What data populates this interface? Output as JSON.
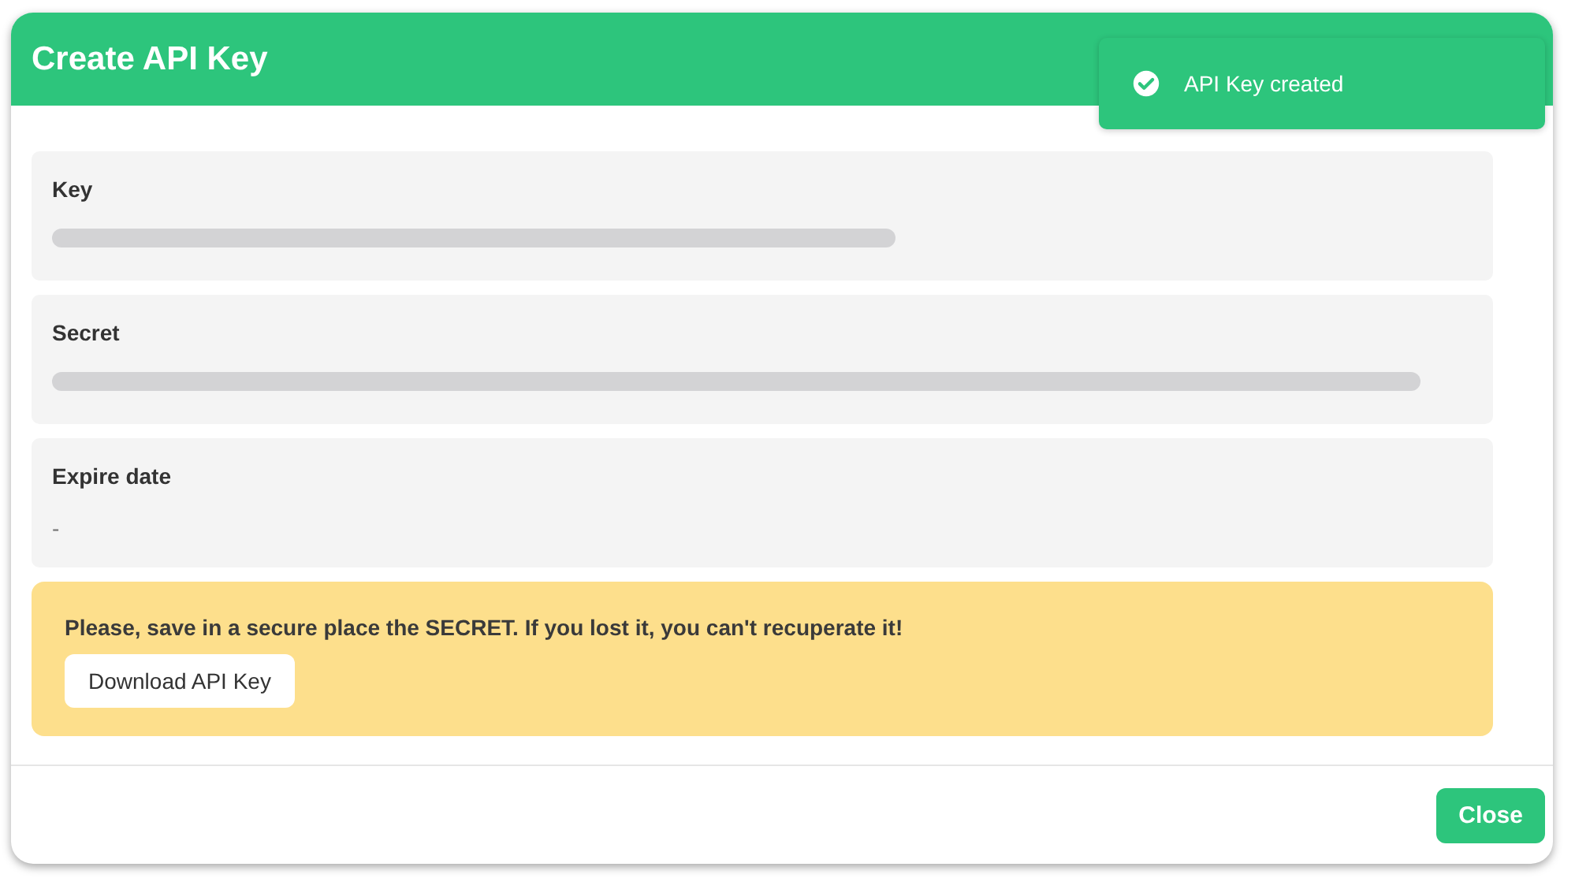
{
  "dialog": {
    "title": "Create API Key"
  },
  "fields": [
    {
      "label": "Key",
      "redacted": true
    },
    {
      "label": "Secret",
      "redacted": true
    },
    {
      "label": "Expire date",
      "redacted": false,
      "value": "-"
    }
  ],
  "warning": {
    "message": "Please, save in a secure place the SECRET. If you lost it, you can't recuperate it!",
    "button": "Download API Key"
  },
  "footer": {
    "buttons": [
      "Close"
    ]
  },
  "toast": {
    "message": "API Key created",
    "kind": "success"
  }
}
